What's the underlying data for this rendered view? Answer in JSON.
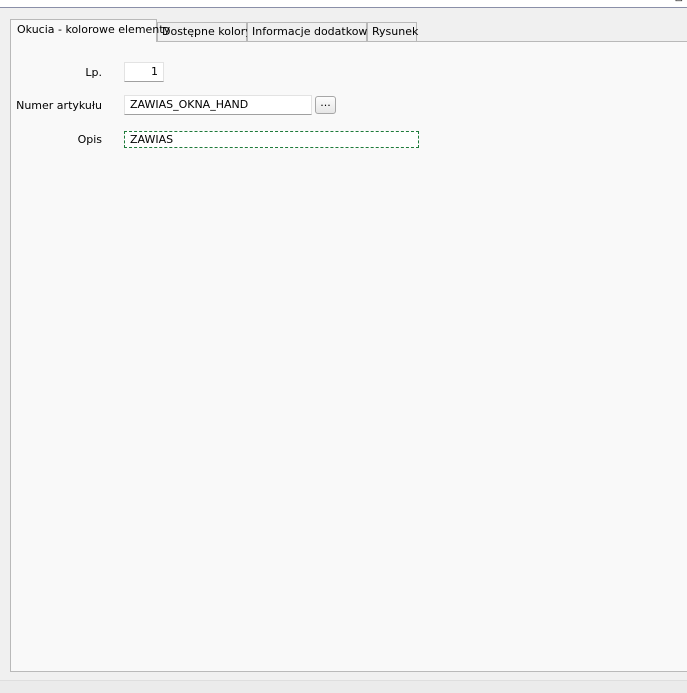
{
  "window": {
    "corner_glyph": "⊟"
  },
  "tabs": [
    {
      "label": "Okucia - kolorowe elementy"
    },
    {
      "label": "Dostępne kolory"
    },
    {
      "label": "Informacje dodatkowe"
    },
    {
      "label": "Rysunek"
    }
  ],
  "active_tab": "Okucia - kolorowe elementy",
  "form": {
    "lp": {
      "label": "Lp.",
      "value": "1"
    },
    "numer_artykulu": {
      "label": "Numer artykułu",
      "value": "ZAWIAS_OKNA_HAND",
      "browse_label": "..."
    },
    "opis": {
      "label": "Opis",
      "value": "ZAWIAS"
    }
  },
  "colors": {
    "focus_border": "#1e7b3a",
    "panel_background": "#f9f9f9",
    "window_background": "#f0f0f0"
  }
}
